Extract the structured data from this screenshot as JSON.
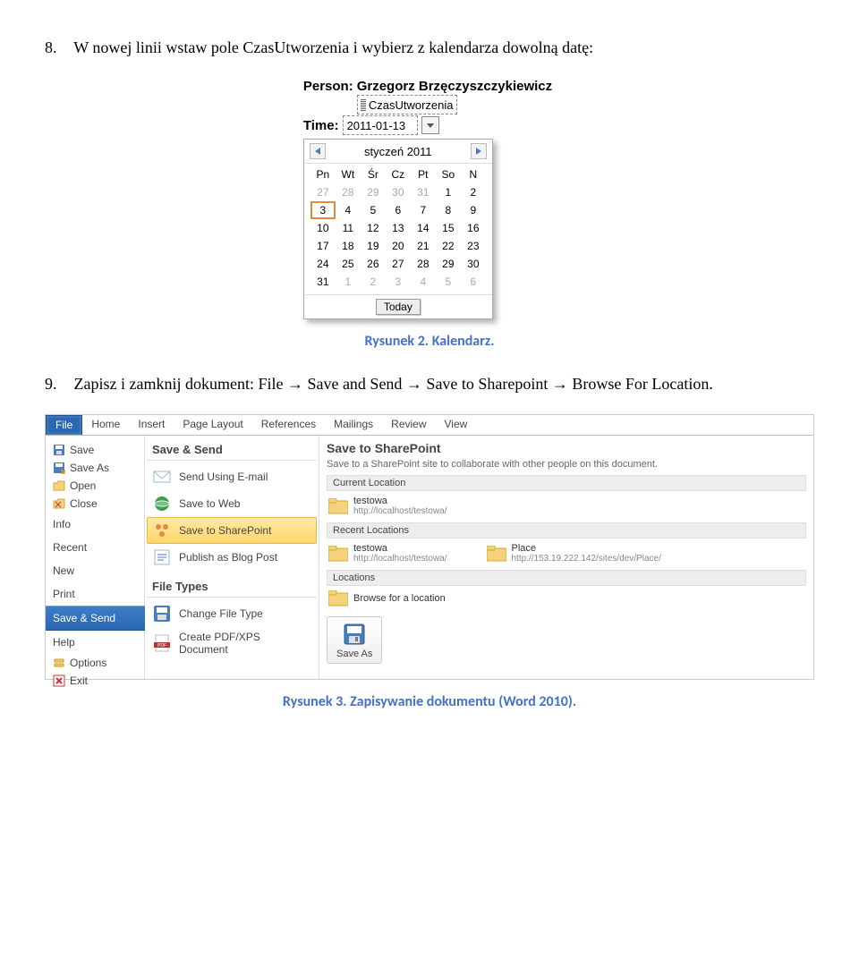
{
  "step8": {
    "num": "8.",
    "text": "W nowej linii wstaw pole CzasUtworzenia i wybierz z kalendarza dowolną datę:"
  },
  "widget": {
    "person_label": "Person:",
    "person_value": "Grzegorz Brzęczyszczykiewicz",
    "field_name": "CzasUtworzenia",
    "time_label": "Time:",
    "time_value": "2011-01-13"
  },
  "calendar": {
    "month": "styczeń 2011",
    "dow": [
      "Pn",
      "Wt",
      "Śr",
      "Cz",
      "Pt",
      "So",
      "N"
    ],
    "weeks": [
      [
        {
          "d": "27",
          "o": true
        },
        {
          "d": "28",
          "o": true
        },
        {
          "d": "29",
          "o": true
        },
        {
          "d": "30",
          "o": true
        },
        {
          "d": "31",
          "o": true
        },
        {
          "d": "1"
        },
        {
          "d": "2"
        }
      ],
      [
        {
          "d": "3",
          "sel": true
        },
        {
          "d": "4"
        },
        {
          "d": "5"
        },
        {
          "d": "6"
        },
        {
          "d": "7"
        },
        {
          "d": "8"
        },
        {
          "d": "9"
        }
      ],
      [
        {
          "d": "10"
        },
        {
          "d": "11"
        },
        {
          "d": "12"
        },
        {
          "d": "13"
        },
        {
          "d": "14"
        },
        {
          "d": "15"
        },
        {
          "d": "16"
        }
      ],
      [
        {
          "d": "17"
        },
        {
          "d": "18"
        },
        {
          "d": "19"
        },
        {
          "d": "20"
        },
        {
          "d": "21"
        },
        {
          "d": "22"
        },
        {
          "d": "23"
        }
      ],
      [
        {
          "d": "24"
        },
        {
          "d": "25"
        },
        {
          "d": "26"
        },
        {
          "d": "27"
        },
        {
          "d": "28"
        },
        {
          "d": "29"
        },
        {
          "d": "30"
        }
      ],
      [
        {
          "d": "31"
        },
        {
          "d": "1",
          "o": true
        },
        {
          "d": "2",
          "o": true
        },
        {
          "d": "3",
          "o": true
        },
        {
          "d": "4",
          "o": true
        },
        {
          "d": "5",
          "o": true
        },
        {
          "d": "6",
          "o": true
        }
      ]
    ],
    "today": "Today"
  },
  "caption2": "Rysunek 2. Kalendarz.",
  "step9": {
    "num": "9.",
    "text": "Zapisz i zamknij dokument: File → Save and Send → Save to Sharepoint → Browse For Location."
  },
  "word": {
    "tabs": [
      "File",
      "Home",
      "Insert",
      "Page Layout",
      "References",
      "Mailings",
      "Review",
      "View"
    ],
    "left": [
      {
        "label": "Save",
        "icon": "save"
      },
      {
        "label": "Save As",
        "icon": "saveas"
      },
      {
        "label": "Open",
        "icon": "open"
      },
      {
        "label": "Close",
        "icon": "close"
      },
      {
        "label": "Info",
        "big": true
      },
      {
        "label": "Recent",
        "big": true
      },
      {
        "label": "New",
        "big": true
      },
      {
        "label": "Print",
        "big": true
      },
      {
        "label": "Save & Send",
        "big": true,
        "sel": true
      },
      {
        "label": "Help",
        "big": true
      },
      {
        "label": "Options",
        "icon": "options"
      },
      {
        "label": "Exit",
        "icon": "exit"
      }
    ],
    "mid": {
      "section1": "Save & Send",
      "options1": [
        {
          "label": "Send Using E-mail",
          "icon": "email"
        },
        {
          "label": "Save to Web",
          "icon": "web"
        },
        {
          "label": "Save to SharePoint",
          "icon": "sharepoint",
          "sel": true
        },
        {
          "label": "Publish as Blog Post",
          "icon": "blog"
        }
      ],
      "section2": "File Types",
      "options2": [
        {
          "label": "Change File Type",
          "icon": "change"
        },
        {
          "label": "Create PDF/XPS Document",
          "icon": "pdf"
        }
      ]
    },
    "right": {
      "heading": "Save to SharePoint",
      "desc": "Save to a SharePoint site to collaborate with other people on this document.",
      "sub_current": "Current Location",
      "current": {
        "name": "testowa",
        "url": "http://localhost/testowa/"
      },
      "sub_recent": "Recent Locations",
      "recent": [
        {
          "name": "testowa",
          "url": "http://localhost/testowa/"
        },
        {
          "name": "Place",
          "url": "http://153.19.222.142/sites/dev/Place/"
        }
      ],
      "sub_loc": "Locations",
      "browse": "Browse for a location",
      "saveas": "Save As"
    }
  },
  "caption3": "Rysunek 3. Zapisywanie dokumentu (Word 2010)."
}
